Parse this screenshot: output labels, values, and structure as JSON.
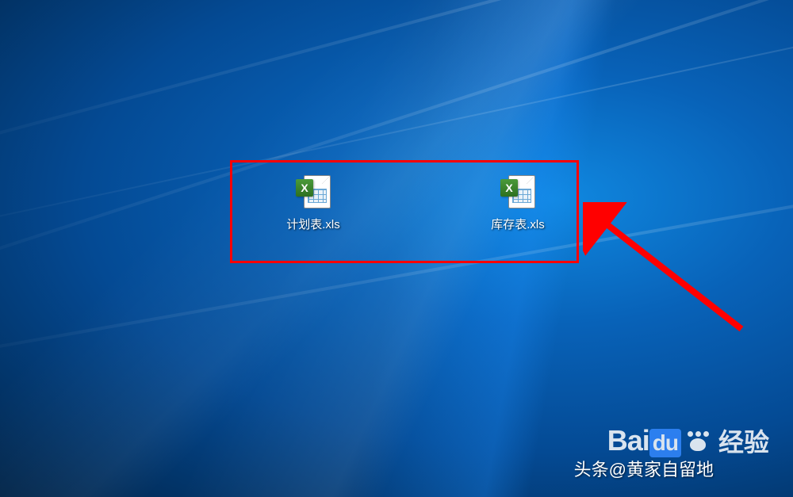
{
  "desktop": {
    "icons": [
      {
        "label": "计划表.xls",
        "type": "xls"
      },
      {
        "label": "库存表.xls",
        "type": "xls"
      }
    ]
  },
  "annotations": {
    "highlight_color": "#ff0000",
    "arrow_color": "#ff0000"
  },
  "watermarks": {
    "baidu_prefix": "Bai",
    "baidu_suffix": "du",
    "baidu_jingyan": "经验",
    "author": "头条@黄家自留地"
  }
}
